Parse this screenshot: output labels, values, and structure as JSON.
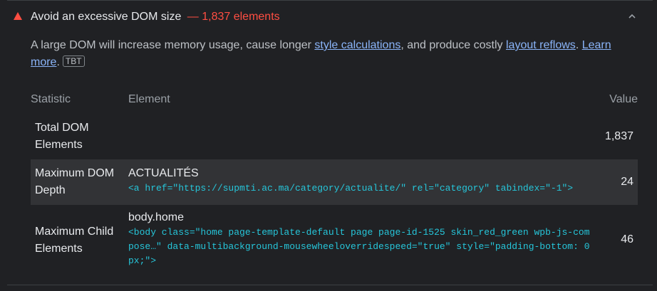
{
  "audit": {
    "title": "Avoid an excessive DOM size",
    "display_value": "— 1,837 elements",
    "description": {
      "part1": "A large DOM will increase memory usage, cause longer ",
      "link1": "style calculations",
      "part2": ", and produce costly ",
      "link2": "layout reflows",
      "part3": ". ",
      "link3": "Learn more",
      "part4": ".",
      "badge": "TBT"
    },
    "colors": {
      "fail": "#ff4e42",
      "link": "#8ab4f8",
      "snippet": "#26c6da"
    }
  },
  "table": {
    "headers": {
      "statistic": "Statistic",
      "element": "Element",
      "value": "Value"
    },
    "rows": [
      {
        "statistic": "Total DOM Elements",
        "element_label": "",
        "element_snippet": "",
        "value": "1,837"
      },
      {
        "statistic": "Maximum DOM Depth",
        "element_label": "ACTUALITÉS",
        "element_snippet": "<a href=\"https://supmti.ac.ma/category/actualite/\" rel=\"category\" tabindex=\"-1\">",
        "value": "24"
      },
      {
        "statistic": "Maximum Child Elements",
        "element_label": "body.home",
        "element_snippet": "<body class=\"home page-template-default page page-id-1525 skin_red_green wpb-js-compose…\" data-multibackground-mousewheeloverridespeed=\"true\" style=\"padding-bottom: 0px;\">",
        "value": "46"
      }
    ]
  }
}
